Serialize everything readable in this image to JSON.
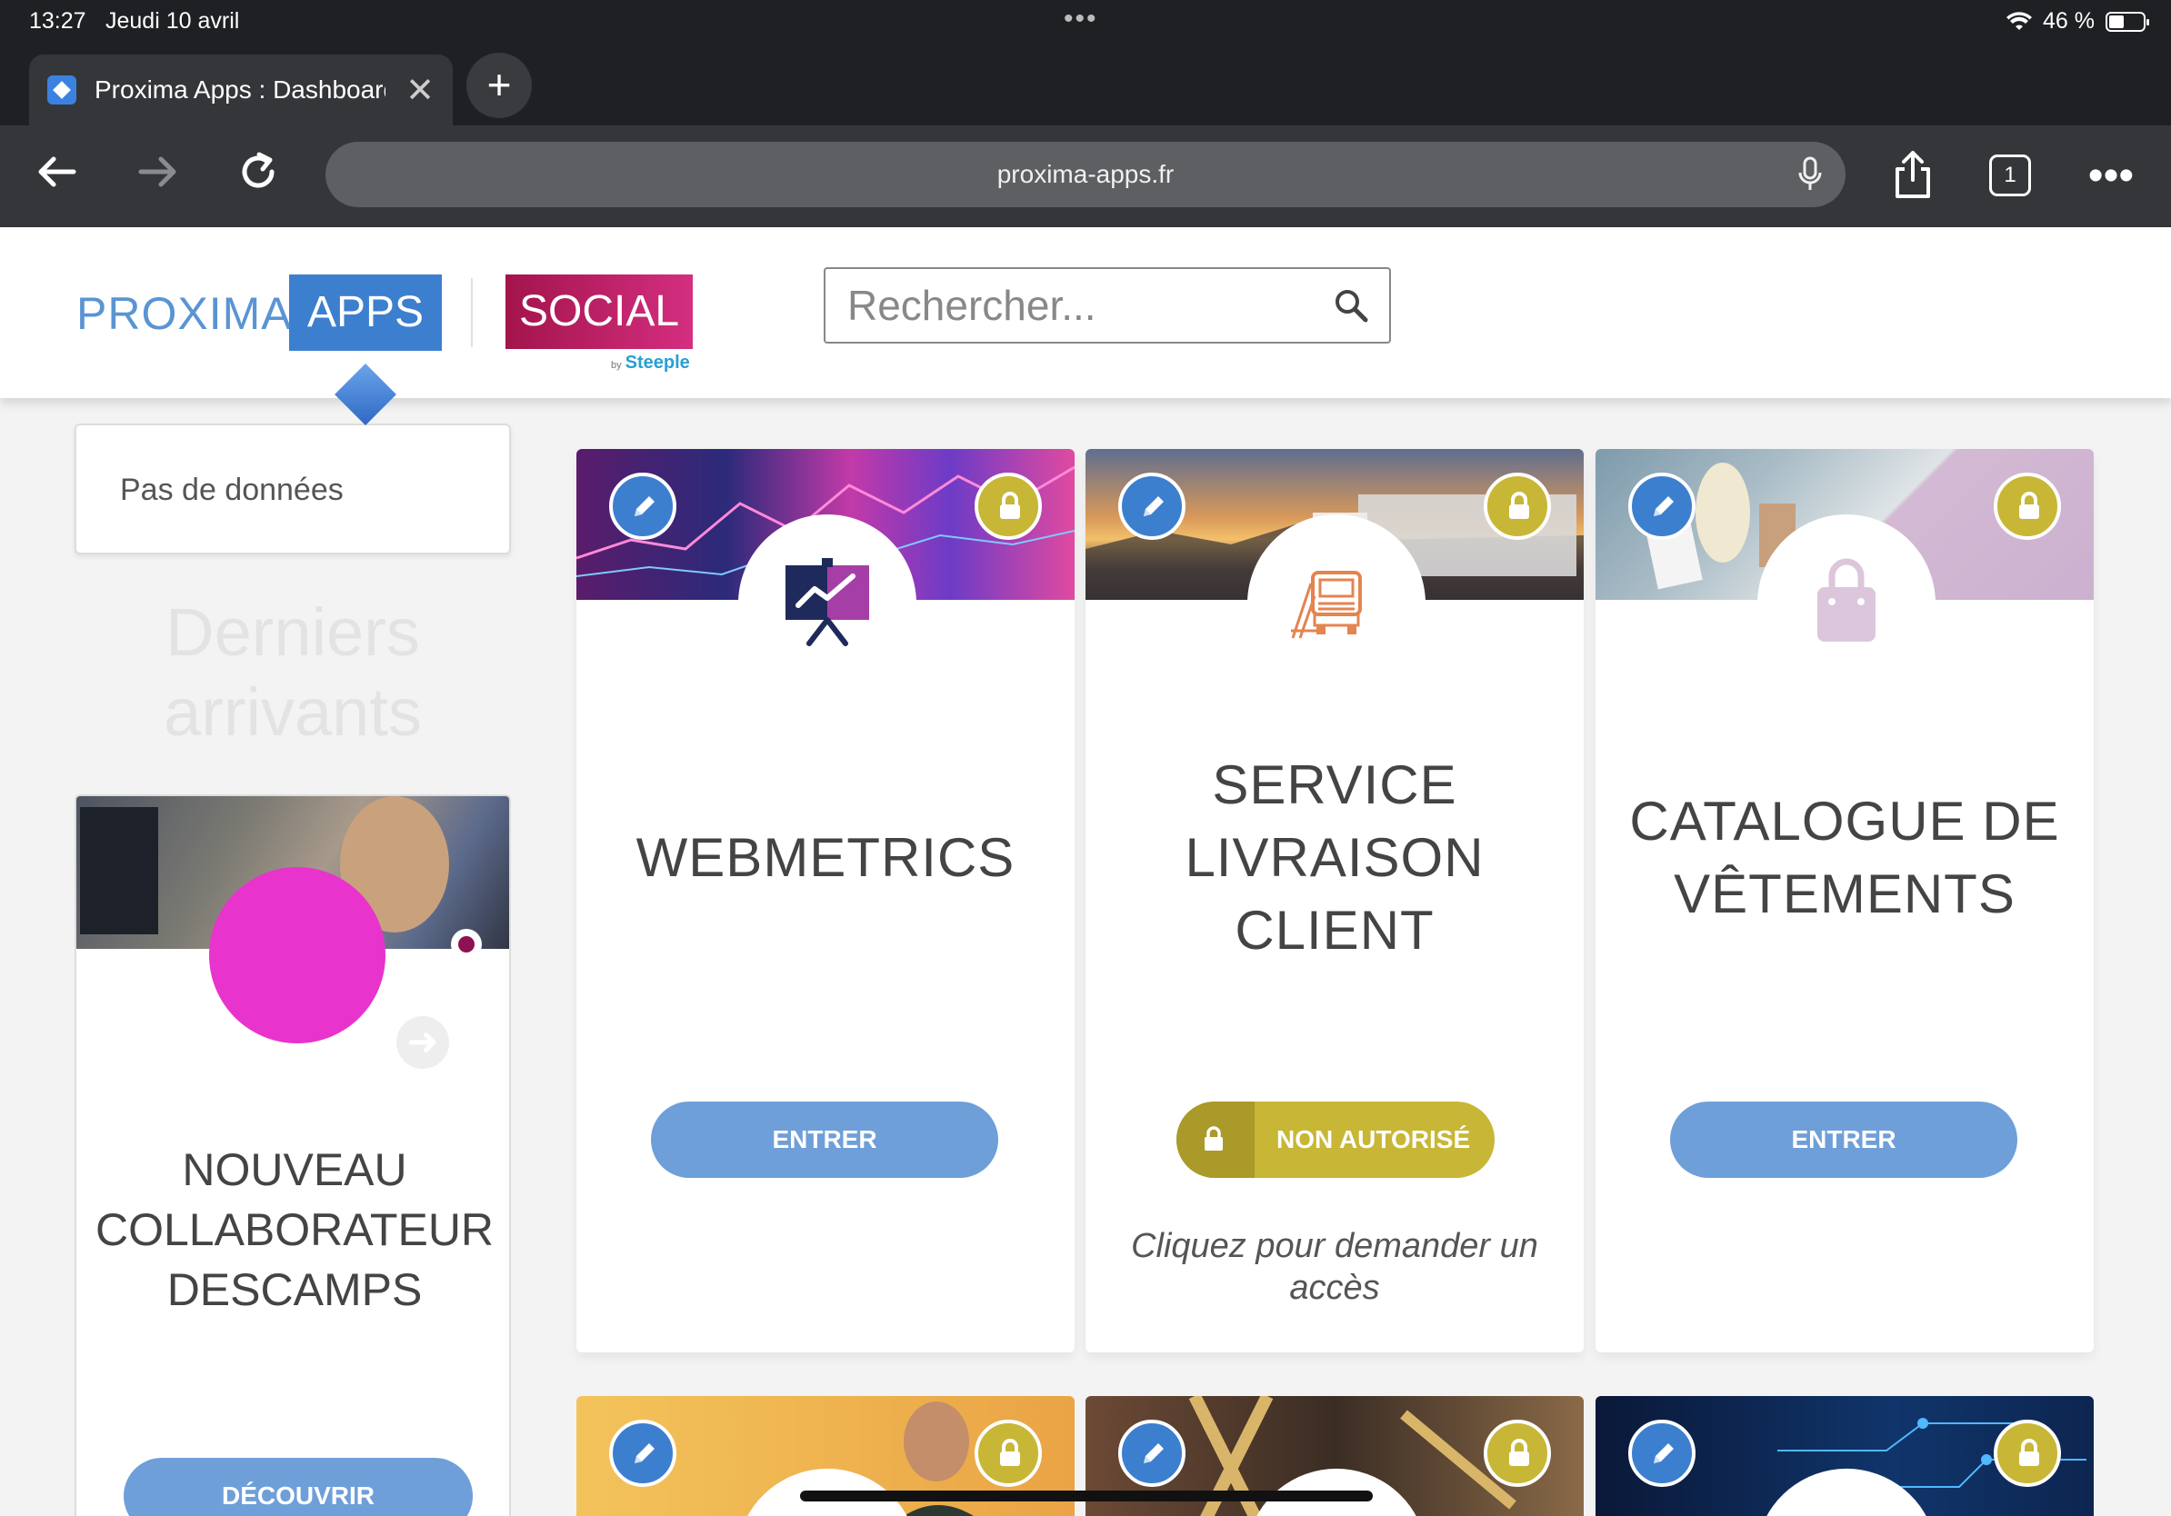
{
  "status_bar": {
    "time": "13:27",
    "date": "Jeudi 10 avril",
    "battery": "46 %"
  },
  "browser": {
    "tab_title": "Proxima Apps : Dashboard",
    "url": "proxima-apps.fr",
    "tab_count": "1"
  },
  "header": {
    "logo_text": "PROXIMA",
    "logo_apps": "APPS",
    "logo_social": "SOCIAL",
    "logo_by": "by",
    "logo_steeple": "Steeple",
    "search_placeholder": "Rechercher..."
  },
  "sidebar": {
    "no_data": "Pas de données",
    "recent_title": "Derniers arrivants",
    "news": {
      "title": "NOUVEAU COLLABORATEUR DESCAMPS",
      "button": "DÉCOUVRIR"
    }
  },
  "apps": [
    {
      "title": "WEBMETRICS",
      "button": "ENTRER",
      "status": "enter",
      "icon": "presentation-chart-icon",
      "accent": "#a63ea7"
    },
    {
      "title": "SERVICE LIVRAISON CLIENT",
      "button": "NON AUTORISÉ",
      "status": "denied",
      "hint": "Cliquez pour demander un accès",
      "icon": "truck-icon",
      "accent": "#e4844f"
    },
    {
      "title": "CATALOGUE DE VÊTEMENTS",
      "button": "ENTRER",
      "status": "enter",
      "icon": "shopping-bag-icon",
      "accent": "#dcc6dc"
    }
  ],
  "colors": {
    "primary_blue": "#3d7fcf",
    "button_blue": "#6f9fd8",
    "lock_gold": "#c8b636",
    "social_magenta": "#c21e6a"
  }
}
